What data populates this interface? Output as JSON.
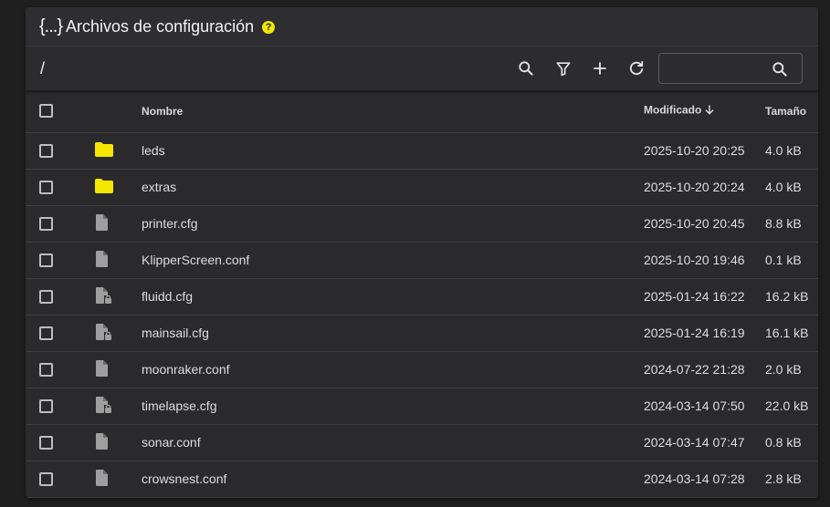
{
  "header": {
    "title_icon": "{...}",
    "title": "Archivos de configuración",
    "help_icon": "help-circle-icon",
    "help_glyph": "?",
    "help_color": "#f5e600"
  },
  "toolbar": {
    "path": "/",
    "search_placeholder": "",
    "search_value": ""
  },
  "table": {
    "headers": {
      "name": "Nombre",
      "modified": "Modificado",
      "size": "Tamaño"
    },
    "sort": {
      "column": "modified",
      "direction": "desc"
    },
    "rows": [
      {
        "type": "folder",
        "name": "leds",
        "modified": "2025-10-20 20:25",
        "size": "4.0 kB"
      },
      {
        "type": "folder",
        "name": "extras",
        "modified": "2025-10-20 20:24",
        "size": "4.0 kB"
      },
      {
        "type": "file",
        "name": "printer.cfg",
        "modified": "2025-10-20 20:45",
        "size": "8.8 kB"
      },
      {
        "type": "file",
        "name": "KlipperScreen.conf",
        "modified": "2025-10-20 19:46",
        "size": "0.1 kB"
      },
      {
        "type": "locked-file",
        "name": "fluidd.cfg",
        "modified": "2025-01-24 16:22",
        "size": "16.2 kB"
      },
      {
        "type": "locked-file",
        "name": "mainsail.cfg",
        "modified": "2025-01-24 16:19",
        "size": "16.1 kB"
      },
      {
        "type": "file",
        "name": "moonraker.conf",
        "modified": "2024-07-22 21:28",
        "size": "2.0 kB"
      },
      {
        "type": "locked-file",
        "name": "timelapse.cfg",
        "modified": "2024-03-14 07:50",
        "size": "22.0 kB"
      },
      {
        "type": "file",
        "name": "sonar.conf",
        "modified": "2024-03-14 07:47",
        "size": "0.8 kB"
      },
      {
        "type": "file",
        "name": "crowsnest.conf",
        "modified": "2024-03-14 07:28",
        "size": "2.8 kB"
      }
    ]
  },
  "colors": {
    "folder": "#f5e600",
    "file": "#9e9e9e"
  }
}
